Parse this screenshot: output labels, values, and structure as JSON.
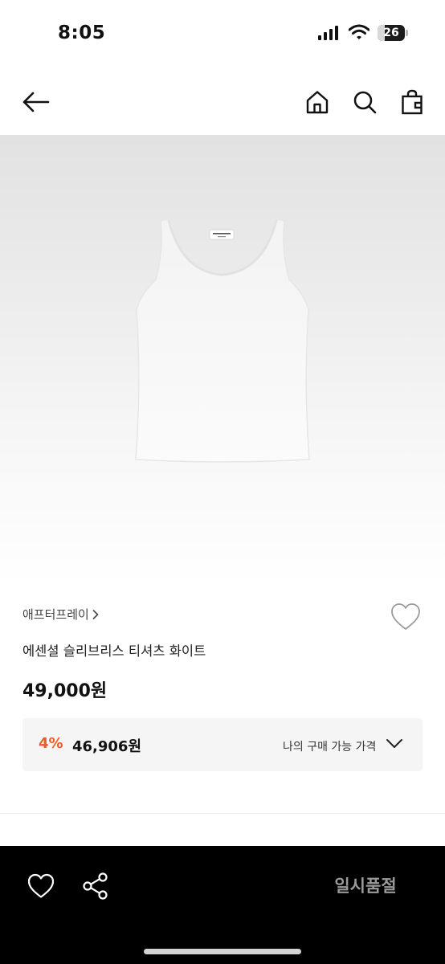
{
  "status_bar": {
    "time": "8:05",
    "battery_level": "26"
  },
  "product": {
    "brand": "애프터프레이",
    "name": "에센셜 슬리브리스 티셔츠 화이트",
    "price": "49,000원"
  },
  "benefit": {
    "discount_rate": "4%",
    "discount_price": "46,906원",
    "label": "나의 구매 가능 가격"
  },
  "bottom_bar": {
    "status_label": "일시품절"
  },
  "icons": {
    "nav": [
      "back-arrow-icon",
      "home-icon",
      "search-icon",
      "shopping-bag-icon"
    ],
    "product": [
      "heart-icon",
      "chevron-right-icon",
      "chevron-down-icon"
    ],
    "bottom": [
      "heart-icon",
      "share-icon"
    ]
  },
  "colors": {
    "discount_accent": "#f15a24",
    "bottom_bar_bg": "#000000",
    "soldout_text": "#9a9a9a",
    "benefit_bg": "#f5f5f5"
  }
}
